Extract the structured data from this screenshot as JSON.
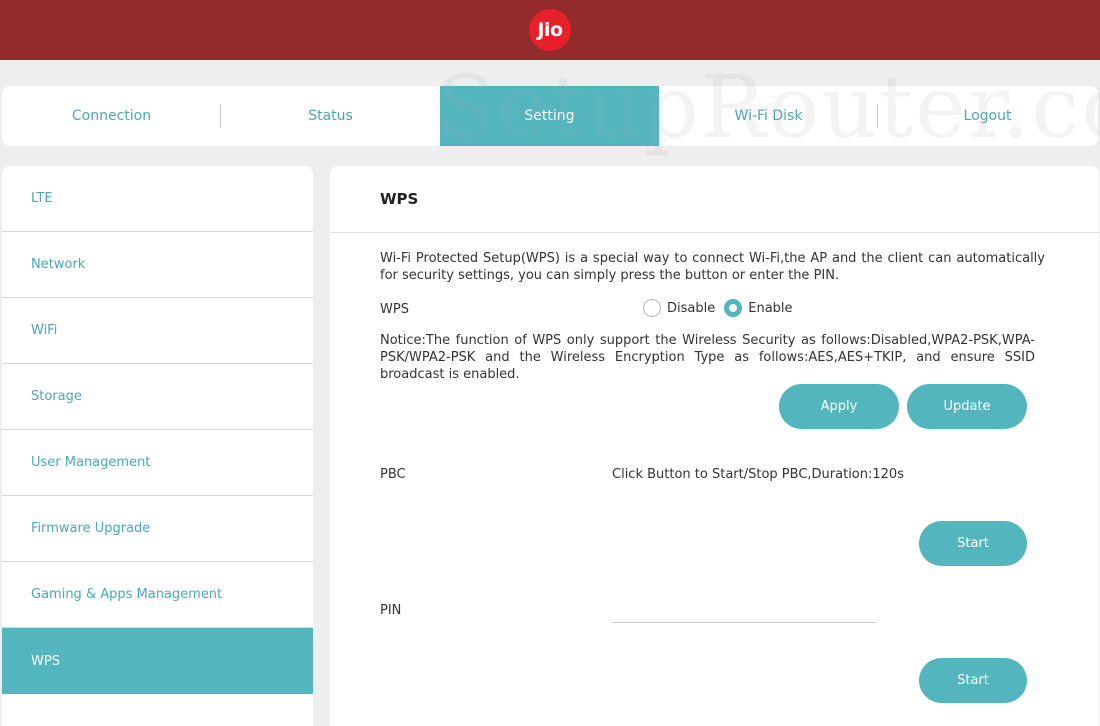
{
  "header": {
    "logo_text": "Jio",
    "bg_color": "#932a2c",
    "logo_color": "#e8202a"
  },
  "watermark": "SetupRouter.co",
  "nav": {
    "tabs": [
      {
        "label": "Connection",
        "active": false
      },
      {
        "label": "Status",
        "active": false
      },
      {
        "label": "Setting",
        "active": true
      },
      {
        "label": "Wi-Fi Disk",
        "active": false
      },
      {
        "label": "Logout",
        "active": false
      }
    ]
  },
  "sidebar": {
    "items": [
      {
        "label": "LTE",
        "active": false
      },
      {
        "label": "Network",
        "active": false
      },
      {
        "label": "WiFi",
        "active": false
      },
      {
        "label": "Storage",
        "active": false
      },
      {
        "label": "User Management",
        "active": false
      },
      {
        "label": "Firmware Upgrade",
        "active": false
      },
      {
        "label": "Gaming & Apps Management",
        "active": false
      },
      {
        "label": "WPS",
        "active": true
      }
    ]
  },
  "main": {
    "title": "WPS",
    "description": "Wi-Fi Protected Setup(WPS) is a special way to connect Wi-Fi,the AP and the client can automatically for security settings, you can simply press the button or enter the PIN.",
    "wps_label": "WPS",
    "radio_disable": "Disable",
    "radio_enable": "Enable",
    "wps_selected": "Enable",
    "notice": "Notice:The function of WPS only support the Wireless Security as follows:Disabled,WPA2-PSK,WPA-PSK/WPA2-PSK and the Wireless Encryption Type as follows:AES,AES+TKIP, and ensure SSID broadcast is enabled.",
    "apply_label": "Apply",
    "update_label": "Update",
    "pbc_label": "PBC",
    "pbc_hint": "Click Button to Start/Stop PBC,Duration:120s",
    "pbc_start_label": "Start",
    "pin_label": "PIN",
    "pin_value": "",
    "pin_start_label": "Start"
  },
  "colors": {
    "accent": "#53b6bf",
    "link": "#4aa8b5"
  }
}
